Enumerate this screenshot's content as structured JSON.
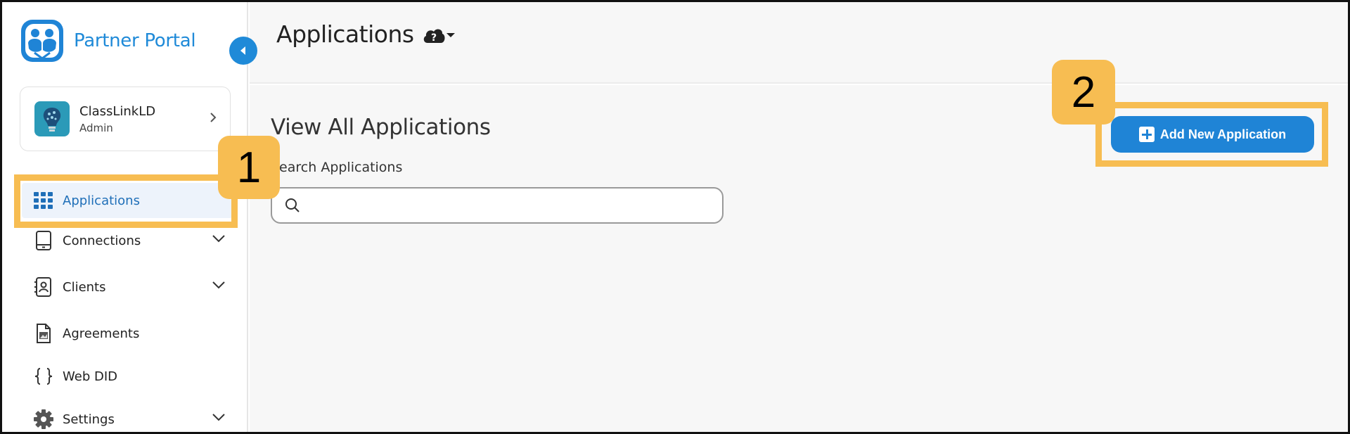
{
  "sidebar": {
    "brand": {
      "name": "Partner Portal"
    },
    "account": {
      "name": "ClassLinkLD",
      "role": "Admin"
    },
    "items": [
      {
        "label": "Applications"
      },
      {
        "label": "Connections"
      },
      {
        "label": "Clients"
      },
      {
        "label": "Agreements"
      },
      {
        "label": "Web DID"
      },
      {
        "label": "Settings"
      }
    ]
  },
  "header": {
    "title": "Applications"
  },
  "main": {
    "section_title": "View All Applications",
    "search_label": "Search Applications",
    "search_value": "",
    "add_button_label": "Add New Application"
  },
  "callouts": [
    {
      "number": "1"
    },
    {
      "number": "2"
    }
  ],
  "colors": {
    "accent": "#1f84d6",
    "callout": "#f7bd52",
    "active_nav_bg": "#edf3fb"
  }
}
